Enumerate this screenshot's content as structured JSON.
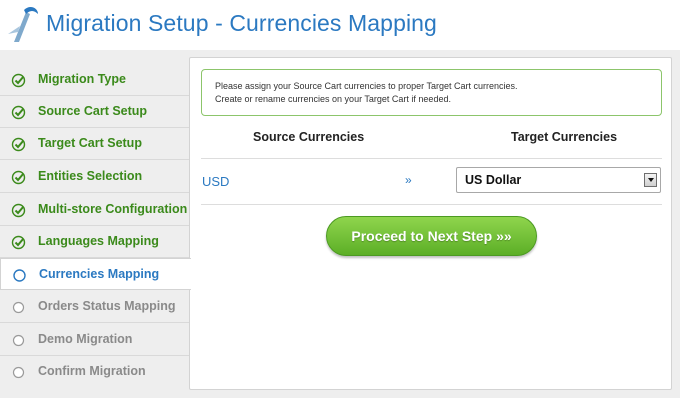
{
  "header": {
    "title": "Migration Setup - Currencies Mapping"
  },
  "sidebar": {
    "steps": [
      {
        "label": "Migration Type",
        "state": "done"
      },
      {
        "label": "Source Cart Setup",
        "state": "done"
      },
      {
        "label": "Target Cart Setup",
        "state": "done"
      },
      {
        "label": "Entities Selection",
        "state": "done"
      },
      {
        "label": "Multi-store Configuration",
        "state": "done"
      },
      {
        "label": "Languages Mapping",
        "state": "done"
      },
      {
        "label": "Currencies Mapping",
        "state": "active"
      },
      {
        "label": "Orders Status Mapping",
        "state": "pending"
      },
      {
        "label": "Demo Migration",
        "state": "pending"
      },
      {
        "label": "Confirm Migration",
        "state": "pending"
      }
    ]
  },
  "main": {
    "notice_line1": "Please assign your Source Cart currencies to proper Target Cart currencies.",
    "notice_line2": "Create or rename currencies on your Target Cart if needed.",
    "source_header": "Source Currencies",
    "target_header": "Target Currencies",
    "rows": [
      {
        "source": "USD",
        "arrow": "»",
        "target": "US Dollar"
      }
    ],
    "proceed_label": "Proceed to Next Step »»"
  },
  "colors": {
    "title_blue": "#2b79c1",
    "done_green": "#3b8a1b",
    "button_green": "#6dbf33",
    "notice_border": "#8cc56b"
  }
}
